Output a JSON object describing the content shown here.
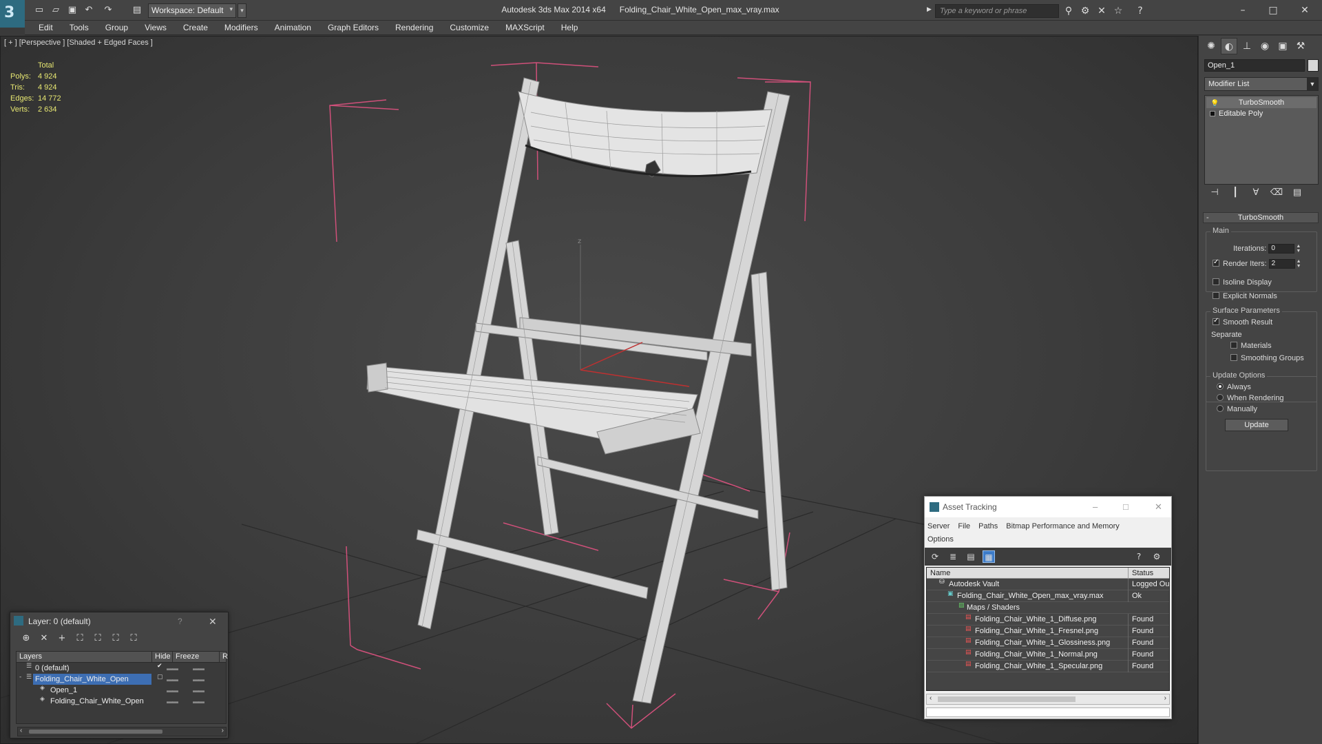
{
  "titlebar": {
    "app_title": "Autodesk 3ds Max  2014 x64",
    "file_name": "Folding_Chair_White_Open_max_vray.max",
    "workspace_label": "Workspace: Default",
    "search_placeholder": "Type a keyword or phrase"
  },
  "menu": [
    "Edit",
    "Tools",
    "Group",
    "Views",
    "Create",
    "Modifiers",
    "Animation",
    "Graph Editors",
    "Rendering",
    "Customize",
    "MAXScript",
    "Help"
  ],
  "viewport": {
    "label": "[ + ] [Perspective ] [Shaded + Edged Faces ]",
    "stats": {
      "header": "Total",
      "polys_label": "Polys:",
      "polys": "4 924",
      "tris_label": "Tris:",
      "tris": "4 924",
      "edges_label": "Edges:",
      "edges": "14 772",
      "verts_label": "Verts:",
      "verts": "2 634"
    },
    "axis_label": "z"
  },
  "command_panel": {
    "object_name": "Open_1",
    "modifier_list": "Modifier List",
    "stack": [
      "TurboSmooth",
      "Editable Poly"
    ],
    "rollout_title": "TurboSmooth",
    "main_group": "Main",
    "iterations_label": "Iterations:",
    "iterations_value": "0",
    "render_iters_label": "Render Iters:",
    "render_iters_value": "2",
    "render_iters_checked": true,
    "isoline_label": "Isoline Display",
    "explicit_normals_label": "Explicit Normals",
    "surface_group": "Surface Parameters",
    "smooth_result_label": "Smooth Result",
    "separate_label": "Separate",
    "materials_label": "Materials",
    "smoothing_groups_label": "Smoothing Groups",
    "update_group": "Update Options",
    "always_label": "Always",
    "when_rendering_label": "When Rendering",
    "manually_label": "Manually",
    "update_button": "Update"
  },
  "layer_dialog": {
    "title": "Layer: 0 (default)",
    "help": "?",
    "columns": [
      "Layers",
      "Hide",
      "Freeze",
      "R"
    ],
    "rows": [
      {
        "name": "0 (default)"
      },
      {
        "name": "Folding_Chair_White_Open"
      },
      {
        "name": "Open_1"
      },
      {
        "name": "Folding_Chair_White_Open"
      }
    ]
  },
  "asset_tracking": {
    "title": "Asset Tracking",
    "menu": [
      "Server",
      "File",
      "Paths",
      "Bitmap Performance and Memory",
      "Options"
    ],
    "columns": [
      "Name",
      "Status"
    ],
    "rows": [
      {
        "name": "Autodesk Vault",
        "status": "Logged Ou"
      },
      {
        "name": "Folding_Chair_White_Open_max_vray.max",
        "status": "Ok"
      },
      {
        "name": "Maps / Shaders",
        "status": ""
      },
      {
        "name": "Folding_Chair_White_1_Diffuse.png",
        "status": "Found"
      },
      {
        "name": "Folding_Chair_White_1_Fresnel.png",
        "status": "Found"
      },
      {
        "name": "Folding_Chair_White_1_Glossiness.png",
        "status": "Found"
      },
      {
        "name": "Folding_Chair_White_1_Normal.png",
        "status": "Found"
      },
      {
        "name": "Folding_Chair_White_1_Specular.png",
        "status": "Found"
      }
    ]
  },
  "colors": {
    "stats_text": "#e8e872",
    "selection": "#3d6eb3",
    "bounding_box": "#d0507a",
    "wire": "#e8e8e8"
  }
}
